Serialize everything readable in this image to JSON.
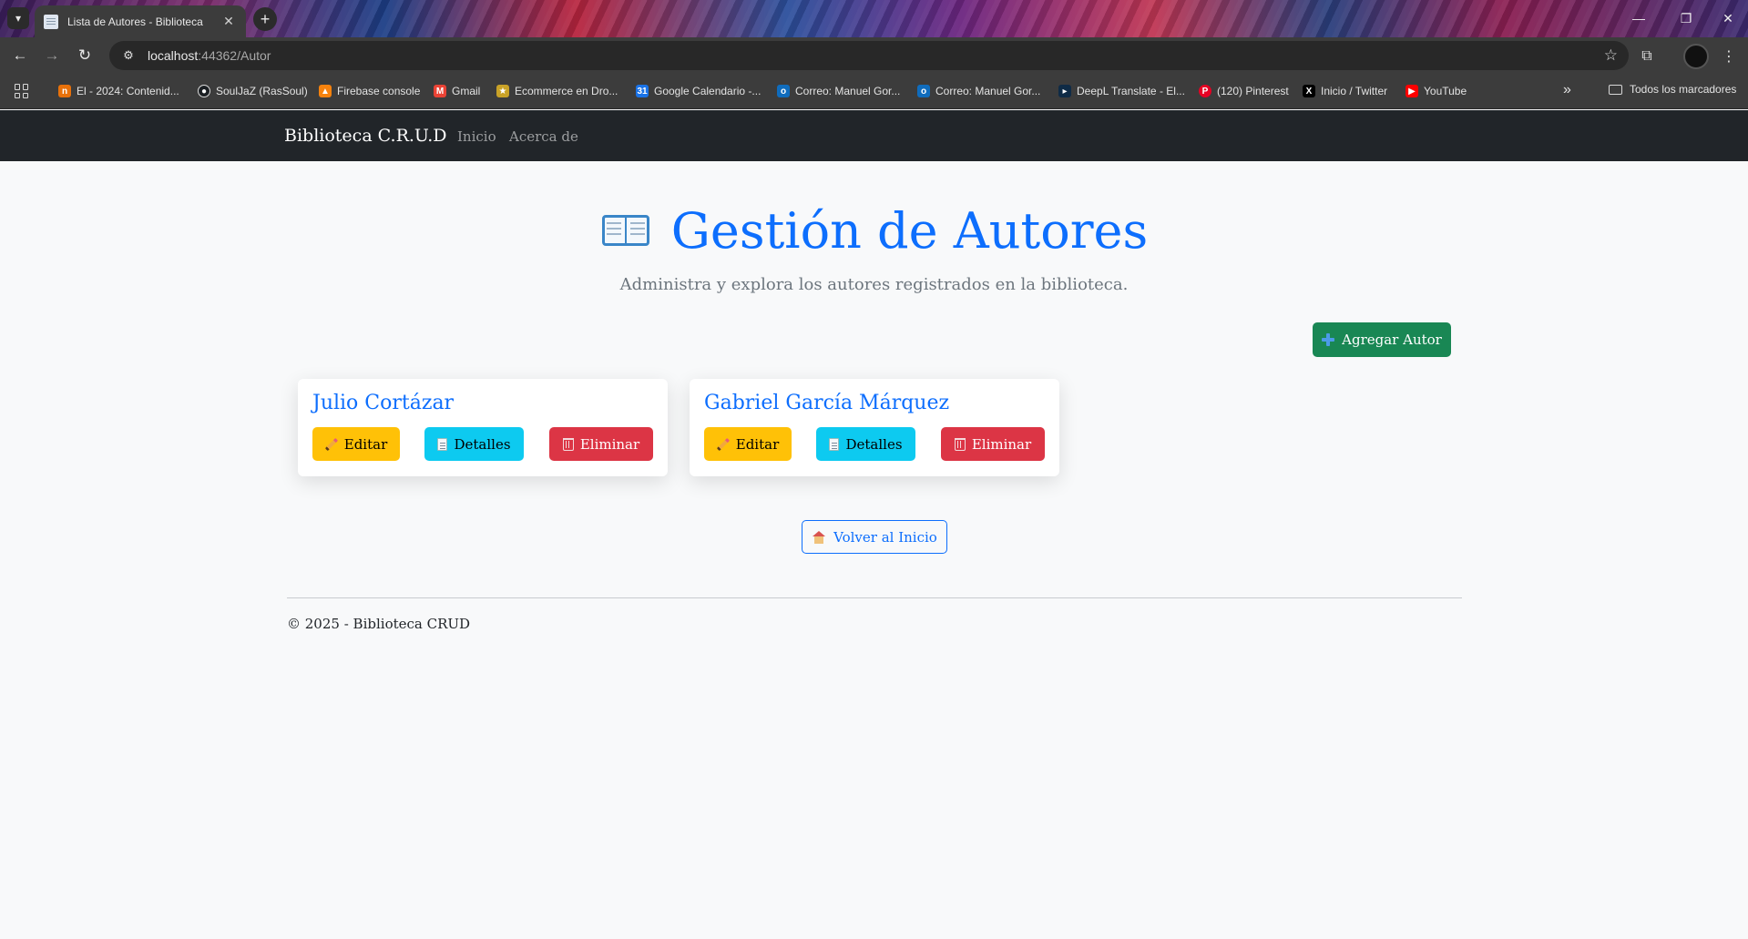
{
  "browser": {
    "tab_title": "Lista de Autores - Biblioteca",
    "url_host": "localhost",
    "url_rest": ":44362/Autor",
    "bookmarks": [
      {
        "label": "El - 2024: Contenid...",
        "color": "#e8710a",
        "icon": "bars-icon"
      },
      {
        "label": "SoulJaZ (RasSoul)",
        "color": "#1b1f23",
        "icon": "github-icon"
      },
      {
        "label": "Firebase console",
        "color": "#f6820d",
        "icon": "firebase-icon"
      },
      {
        "label": "Gmail",
        "color": "#ea4335",
        "icon": "gmail-icon"
      },
      {
        "label": "Ecommerce en Dro...",
        "color": "#c9a227",
        "icon": "star-badge-icon"
      },
      {
        "label": "Google Calendario -...",
        "color": "#1a73e8",
        "icon": "calendar-icon"
      },
      {
        "label": "Correo: Manuel Gor...",
        "color": "#0f6cbd",
        "icon": "outlook-icon"
      },
      {
        "label": "Correo: Manuel Gor...",
        "color": "#0f6cbd",
        "icon": "outlook-icon"
      },
      {
        "label": "DeepL Translate - El...",
        "color": "#0f2b46",
        "icon": "deepl-icon"
      },
      {
        "label": "(120) Pinterest",
        "color": "#e60023",
        "icon": "pinterest-icon"
      },
      {
        "label": "Inicio / Twitter",
        "color": "#000000",
        "icon": "x-icon"
      },
      {
        "label": "YouTube",
        "color": "#ff0000",
        "icon": "youtube-icon"
      }
    ],
    "all_bookmarks_label": "Todos los marcadores"
  },
  "nav": {
    "brand": "Biblioteca C.R.U.D",
    "links": [
      "Inicio",
      "Acerca de"
    ]
  },
  "page": {
    "title": "Gestión de Autores",
    "subtitle": "Administra y explora los autores registrados en la biblioteca.",
    "add_button": "Agregar Autor",
    "authors": [
      {
        "name": "Julio Cortázar"
      },
      {
        "name": "Gabriel García Márquez"
      }
    ],
    "actions": {
      "edit": "Editar",
      "details": "Detalles",
      "delete": "Eliminar"
    },
    "back_button": "Volver al Inicio",
    "footer": "© 2025 - Biblioteca CRUD"
  },
  "colors": {
    "primary": "#0d6efd",
    "success": "#198754",
    "warning": "#ffc107",
    "info": "#0dcaf0",
    "danger": "#dc3545",
    "navbar": "#212529"
  }
}
